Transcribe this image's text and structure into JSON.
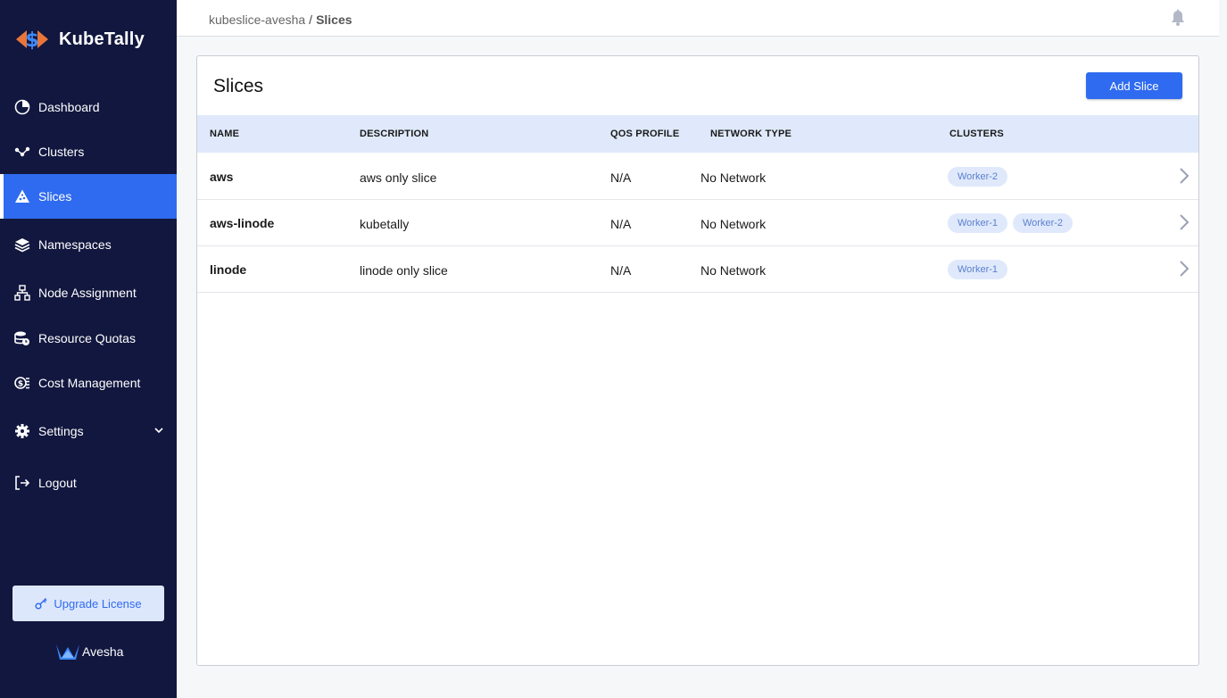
{
  "app": {
    "name": "KubeTally"
  },
  "sidebar": {
    "items": [
      {
        "label": "Dashboard",
        "icon": "pie-chart-icon"
      },
      {
        "label": "Clusters",
        "icon": "cluster-nodes-icon"
      },
      {
        "label": "Slices",
        "icon": "slice-icon",
        "active": true
      },
      {
        "label": "Namespaces",
        "icon": "layers-icon"
      },
      {
        "label": "Node Assignment",
        "icon": "sitemap-icon"
      },
      {
        "label": "Resource Quotas",
        "icon": "database-clock-icon"
      },
      {
        "label": "Cost Management",
        "icon": "money-icon"
      },
      {
        "label": "Settings",
        "icon": "gear-icon"
      },
      {
        "label": "Logout",
        "icon": "logout-icon"
      }
    ],
    "upgrade_label": "Upgrade License",
    "brand_label": "Avesha"
  },
  "topbar": {
    "breadcrumb_root": "kubeslice-avesha",
    "breadcrumb_sep": "/",
    "breadcrumb_current": "Slices"
  },
  "main": {
    "title": "Slices",
    "add_button_label": "Add Slice",
    "columns": [
      "NAME",
      "DESCRIPTION",
      "QOS PROFILE",
      "NETWORK TYPE",
      "CLUSTERS"
    ],
    "rows": [
      {
        "name": "aws",
        "description": "aws only slice",
        "qos": "N/A",
        "network": "No Network",
        "clusters": [
          "Worker-2"
        ]
      },
      {
        "name": "aws-linode",
        "description": "kubetally",
        "qos": "N/A",
        "network": "No Network",
        "clusters": [
          "Worker-1",
          "Worker-2"
        ]
      },
      {
        "name": "linode",
        "description": "linode only slice",
        "qos": "N/A",
        "network": "No Network",
        "clusters": [
          "Worker-1"
        ]
      }
    ]
  },
  "colors": {
    "sidebar_bg": "#12173f",
    "accent": "#2f6bf0",
    "table_header_bg": "#dfe9fb",
    "chip_text": "#5b7fce"
  }
}
